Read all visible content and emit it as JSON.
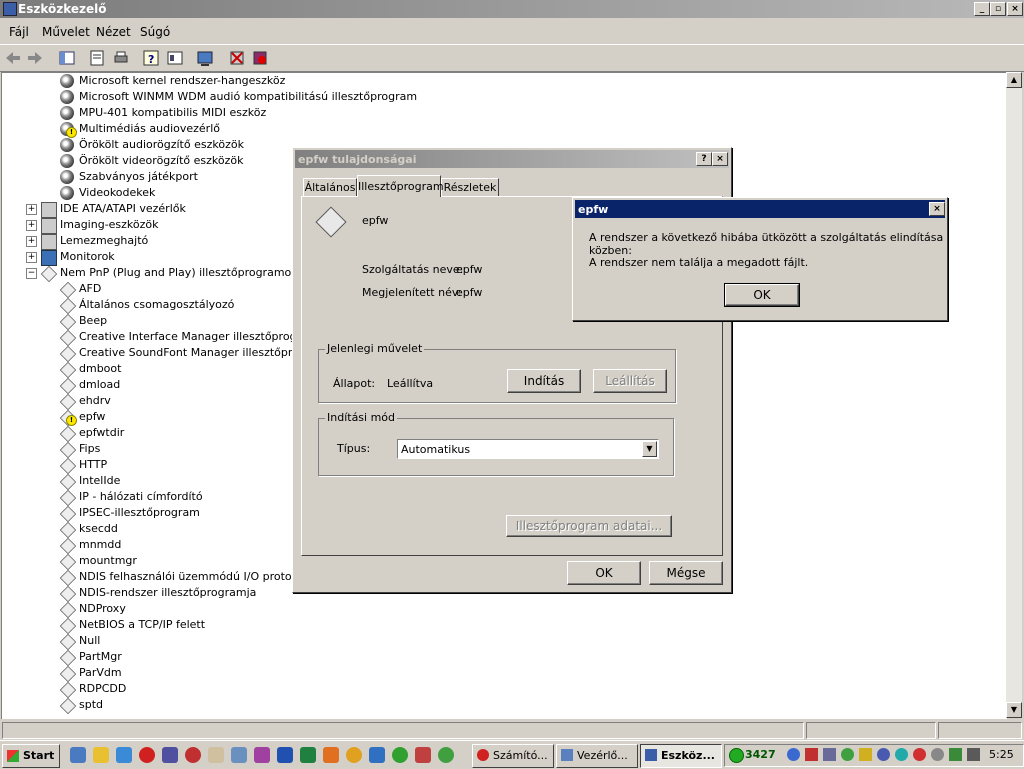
{
  "window": {
    "title": "Eszközkezelő"
  },
  "menu": [
    "Fájl",
    "Művelet",
    "Nézet",
    "Súgó"
  ],
  "tree": [
    {
      "text": "Microsoft kernel rendszer-hangeszköz",
      "icon": "speaker",
      "lvl": 1
    },
    {
      "text": "Microsoft WINMM WDM audió kompatibilitású illesztőprogram",
      "icon": "speaker",
      "lvl": 1
    },
    {
      "text": "MPU-401 kompatibilis MIDI eszköz",
      "icon": "speaker",
      "lvl": 1
    },
    {
      "text": "Multimédiás audiovezérlő",
      "icon": "speaker-warn",
      "lvl": 1
    },
    {
      "text": "Örökölt audiorögzítő eszközök",
      "icon": "speaker",
      "lvl": 1
    },
    {
      "text": "Örökölt videorögzítő eszközök",
      "icon": "speaker",
      "lvl": 1
    },
    {
      "text": "Szabványos játékport",
      "icon": "speaker",
      "lvl": 1
    },
    {
      "text": "Videokodekek",
      "icon": "speaker",
      "lvl": 1
    },
    {
      "text": "IDE ATA/ATAPI vezérlők",
      "icon": "ide",
      "lvl": 0,
      "exp": "+"
    },
    {
      "text": "Imaging-eszközök",
      "icon": "ide",
      "lvl": 0,
      "exp": "+"
    },
    {
      "text": "Lemezmeghajtó",
      "icon": "ide",
      "lvl": 0,
      "exp": "+"
    },
    {
      "text": "Monitorok",
      "icon": "monitor",
      "lvl": 0,
      "exp": "+"
    },
    {
      "text": "Nem PnP (Plug and Play) illesztőprogramok",
      "icon": "diamond",
      "lvl": 0,
      "exp": "−"
    },
    {
      "text": "AFD",
      "icon": "diamond",
      "lvl": 1
    },
    {
      "text": "Általános csomagosztályozó",
      "icon": "diamond",
      "lvl": 1
    },
    {
      "text": "Beep",
      "icon": "diamond",
      "lvl": 1
    },
    {
      "text": "Creative Interface Manager illesztőprogram",
      "icon": "diamond",
      "lvl": 1
    },
    {
      "text": "Creative SoundFont Manager illesztőprogram",
      "icon": "diamond",
      "lvl": 1
    },
    {
      "text": "dmboot",
      "icon": "diamond",
      "lvl": 1
    },
    {
      "text": "dmload",
      "icon": "diamond",
      "lvl": 1
    },
    {
      "text": "ehdrv",
      "icon": "diamond",
      "lvl": 1
    },
    {
      "text": "epfw",
      "icon": "diamond-warn",
      "lvl": 1
    },
    {
      "text": "epfwtdir",
      "icon": "diamond",
      "lvl": 1
    },
    {
      "text": "Fips",
      "icon": "diamond",
      "lvl": 1
    },
    {
      "text": "HTTP",
      "icon": "diamond",
      "lvl": 1
    },
    {
      "text": "IntelIde",
      "icon": "diamond",
      "lvl": 1
    },
    {
      "text": "IP - hálózati címfordító",
      "icon": "diamond",
      "lvl": 1
    },
    {
      "text": "IPSEC-illesztőprogram",
      "icon": "diamond",
      "lvl": 1
    },
    {
      "text": "ksecdd",
      "icon": "diamond",
      "lvl": 1
    },
    {
      "text": "mnmdd",
      "icon": "diamond",
      "lvl": 1
    },
    {
      "text": "mountmgr",
      "icon": "diamond",
      "lvl": 1
    },
    {
      "text": "NDIS felhasználói üzemmódú I/O protokollja",
      "icon": "diamond",
      "lvl": 1
    },
    {
      "text": "NDIS-rendszer illesztőprogramja",
      "icon": "diamond",
      "lvl": 1
    },
    {
      "text": "NDProxy",
      "icon": "diamond",
      "lvl": 1
    },
    {
      "text": "NetBIOS a TCP/IP felett",
      "icon": "diamond",
      "lvl": 1
    },
    {
      "text": "Null",
      "icon": "diamond",
      "lvl": 1
    },
    {
      "text": "PartMgr",
      "icon": "diamond",
      "lvl": 1
    },
    {
      "text": "ParVdm",
      "icon": "diamond",
      "lvl": 1
    },
    {
      "text": "RDPCDD",
      "icon": "diamond",
      "lvl": 1
    },
    {
      "text": "sptd",
      "icon": "diamond",
      "lvl": 1
    }
  ],
  "props": {
    "title": "epfw tulajdonságai",
    "tabs": [
      "Általános",
      "Illesztőprogram",
      "Részletek"
    ],
    "device": "epfw",
    "service_label": "Szolgáltatás neve:",
    "service_value": "epfw",
    "display_label": "Megjelenített név:",
    "display_value": "epfw",
    "current_group": "Jelenlegi művelet",
    "state_label": "Állapot:",
    "state_value": "Leállítva",
    "start_btn": "Indítás",
    "stop_btn": "Leállítás",
    "startup_group": "Indítási mód",
    "type_label": "Típus:",
    "type_value": "Automatikus",
    "details_btn": "Illesztőprogram adatai...",
    "ok": "OK",
    "cancel": "Mégse"
  },
  "error": {
    "title": "epfw",
    "line1": "A rendszer a következő hibába ütközött a szolgáltatás elindítása közben:",
    "line2": "A rendszer nem találja a megadott fájlt.",
    "ok": "OK"
  },
  "taskbar": {
    "start": "Start",
    "tasks": [
      "Számító...",
      "Vezérlő...",
      "Eszköz..."
    ],
    "tray_text": "3427",
    "clock": "5:25"
  },
  "colors": {
    "active_title": "#0a246a",
    "face": "#d4d0c8"
  }
}
